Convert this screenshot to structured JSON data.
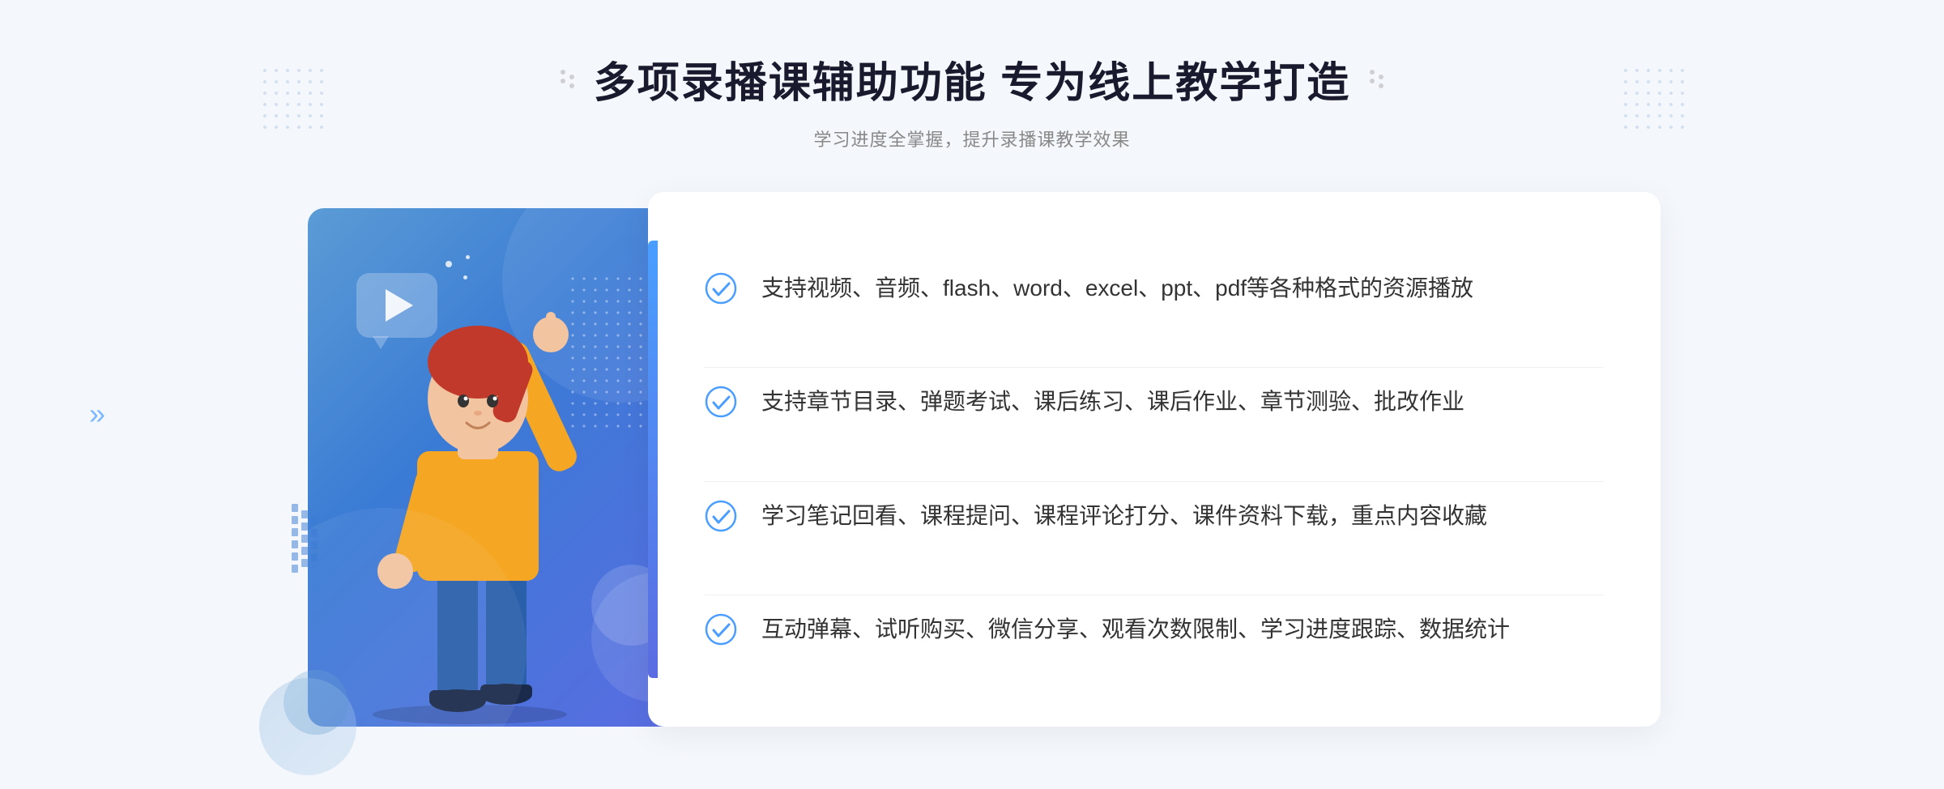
{
  "page": {
    "background_color": "#f4f7fb"
  },
  "header": {
    "main_title": "多项录播课辅助功能 专为线上教学打造",
    "subtitle": "学习进度全掌握，提升录播课教学效果"
  },
  "features": [
    {
      "id": 1,
      "text": "支持视频、音频、flash、word、excel、ppt、pdf等各种格式的资源播放"
    },
    {
      "id": 2,
      "text": "支持章节目录、弹题考试、课后练习、课后作业、章节测验、批改作业"
    },
    {
      "id": 3,
      "text": "学习笔记回看、课程提问、课程评论打分、课件资料下载，重点内容收藏"
    },
    {
      "id": 4,
      "text": "互动弹幕、试听购买、微信分享、观看次数限制、学习进度跟踪、数据统计"
    }
  ],
  "decorations": {
    "arrow_symbol": "»",
    "check_color": "#4a9eff",
    "title_accent_color": "#1a1a2e",
    "subtitle_color": "#999999"
  }
}
